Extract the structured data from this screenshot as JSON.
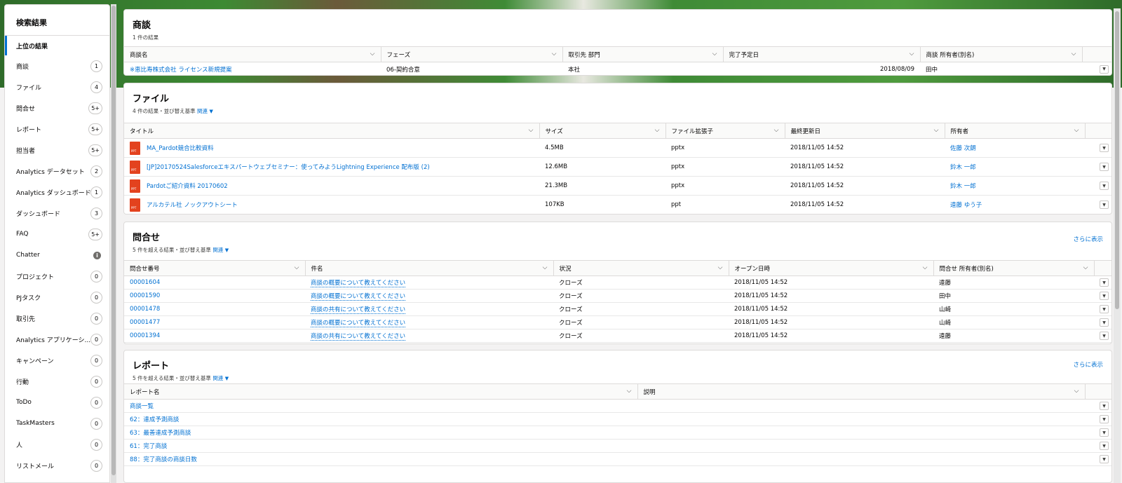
{
  "sidebar": {
    "title": "検索結果",
    "items": [
      {
        "label": "上位の結果",
        "count": ""
      },
      {
        "label": "商談",
        "count": "1"
      },
      {
        "label": "ファイル",
        "count": "4"
      },
      {
        "label": "問合せ",
        "count": "5+"
      },
      {
        "label": "レポート",
        "count": "5+"
      },
      {
        "label": "担当者",
        "count": "5+"
      },
      {
        "label": "Analytics データセット",
        "count": "2"
      },
      {
        "label": "Analytics ダッシュボード",
        "count": "1"
      },
      {
        "label": "ダッシュボード",
        "count": "3"
      },
      {
        "label": "FAQ",
        "count": "5+"
      },
      {
        "label": "Chatter",
        "count": ""
      },
      {
        "label": "プロジェクト",
        "count": "0"
      },
      {
        "label": "PJタスク",
        "count": "0"
      },
      {
        "label": "取引先",
        "count": "0"
      },
      {
        "label": "Analytics アプリケーシ...",
        "count": "0"
      },
      {
        "label": "キャンペーン",
        "count": "0"
      },
      {
        "label": "行動",
        "count": "0"
      },
      {
        "label": "ToDo",
        "count": "0"
      },
      {
        "label": "TaskMasters",
        "count": "0"
      },
      {
        "label": "人",
        "count": "0"
      },
      {
        "label": "リストメール",
        "count": "0"
      }
    ]
  },
  "opportunities": {
    "title": "商談",
    "subtitle": "1 件の結果",
    "columns": [
      "商談名",
      "フェーズ",
      "取引先 部門",
      "完了予定日",
      "商談 所有者(別名)"
    ],
    "rows": [
      [
        "※恵比寿株式会社 ライセンス新規提案",
        "06-契約合意",
        "本社",
        "2018/08/09",
        "田中"
      ]
    ]
  },
  "files": {
    "title": "ファイル",
    "subtitle": "4 件の結果・並び替え基準",
    "sort_label": "関連",
    "columns": [
      "タイトル",
      "サイズ",
      "ファイル拡張子",
      "最終更新日",
      "所有者"
    ],
    "rows": [
      [
        "MA_Pardot競合比較資料",
        "4.5MB",
        "pptx",
        "2018/11/05 14:52",
        "佐藤 次朗"
      ],
      [
        "[JP]20170524Salesforceエキスパートウェブセミナー：使ってみようLightning Experience 配布版 (2)",
        "12.6MB",
        "pptx",
        "2018/11/05 14:52",
        "鈴木 一郎"
      ],
      [
        "Pardotご紹介資料 20170602",
        "21.3MB",
        "pptx",
        "2018/11/05 14:52",
        "鈴木 一郎"
      ],
      [
        "アルカテル社 ノックアウトシート",
        "107KB",
        "ppt",
        "2018/11/05 14:52",
        "遠藤 ゆう子"
      ]
    ]
  },
  "cases": {
    "title": "問合せ",
    "subtitle": "5 件を超える結果・並び替え基準",
    "sort_label": "関連",
    "more": "さらに表示",
    "columns": [
      "問合せ番号",
      "件名",
      "状況",
      "オープン日時",
      "問合せ 所有者(別名)"
    ],
    "rows": [
      [
        "00001604",
        "商談の概要について教えてください",
        "クローズ",
        "2018/11/05 14:52",
        "遠藤"
      ],
      [
        "00001590",
        "商談の概要について教えてください",
        "クローズ",
        "2018/11/05 14:52",
        "田中"
      ],
      [
        "00001478",
        "商談の共有について教えてください",
        "クローズ",
        "2018/11/05 14:52",
        "山崎"
      ],
      [
        "00001477",
        "商談の概要について教えてください",
        "クローズ",
        "2018/11/05 14:52",
        "山崎"
      ],
      [
        "00001394",
        "商談の共有について教えてください",
        "クローズ",
        "2018/11/05 14:52",
        "遠藤"
      ]
    ]
  },
  "reports": {
    "title": "レポート",
    "subtitle": "5 件を超える結果・並び替え基準",
    "sort_label": "関連",
    "more": "さらに表示",
    "columns": [
      "レポート名",
      "説明"
    ],
    "rows": [
      [
        "商談一覧",
        ""
      ],
      [
        "62：達成予測商談",
        ""
      ],
      [
        "63：最善達成予測商談",
        ""
      ],
      [
        "61：完了商談",
        ""
      ],
      [
        "88：完了商談の商談日数",
        ""
      ]
    ]
  },
  "icons": {
    "sort": "chevron-down-icon",
    "row_action": "row-action-menu-icon",
    "file": "ppt-file-icon",
    "info": "info-icon"
  },
  "colors": {
    "link": "#0070d2",
    "file_icon": "#e3421e",
    "active_bar": "#0070d2"
  }
}
